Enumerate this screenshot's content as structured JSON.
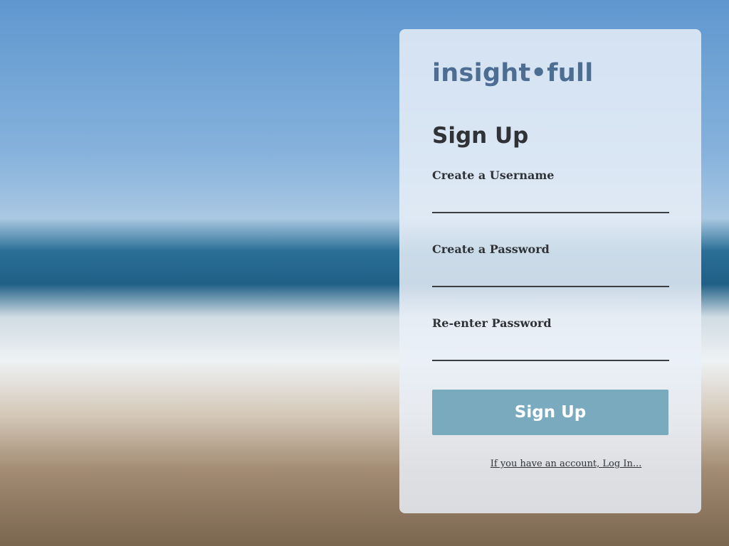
{
  "brand": {
    "logo_text": "insight•full"
  },
  "form": {
    "title": "Sign Up",
    "username": {
      "label": "Create a Username",
      "value": "",
      "placeholder": ""
    },
    "password": {
      "label": "Create a Password",
      "value": "",
      "placeholder": ""
    },
    "confirm_password": {
      "label": "Re-enter Password",
      "value": "",
      "placeholder": ""
    },
    "submit_label": "Sign Up",
    "login_link_text": "If you have an account, Log In..."
  },
  "colors": {
    "logo": "#4d6d92",
    "submit_button": "#79aabd",
    "card_background": "#e9f0f8"
  }
}
